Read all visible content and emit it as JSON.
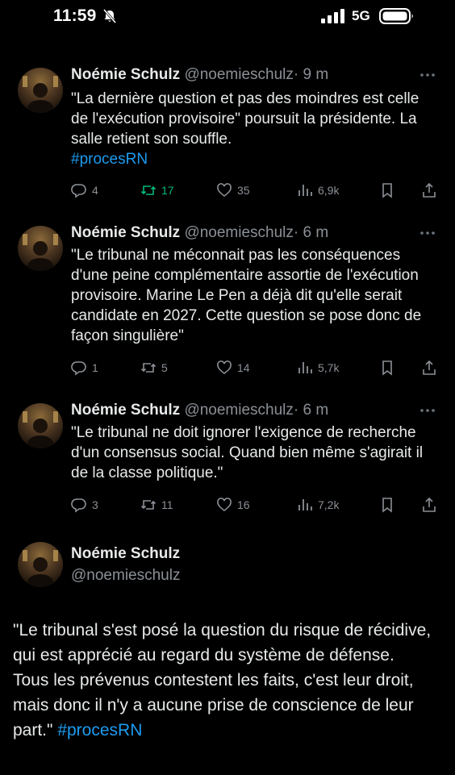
{
  "status_bar": {
    "time": "11:59",
    "network": "5G"
  },
  "tweets": [
    {
      "name": "Noémie Schulz",
      "handle": "@noemieschulz",
      "time": "· 9 m",
      "text": "\"La dernière question et pas des moindres est celle de l'exécution provisoire\" poursuit la présidente. La salle retient son souffle.",
      "hashtag": "#procesRN",
      "replies": "4",
      "retweets": "17",
      "likes": "35",
      "views": "6,9k"
    },
    {
      "name": "Noémie Schulz",
      "handle": "@noemieschulz",
      "time": "· 6 m",
      "text": "\"Le tribunal ne méconnait pas les conséquences d'une peine complémentaire assortie de l'exécution provisoire. Marine Le Pen a déjà dit qu'elle serait candidate en 2027. Cette question se pose donc de façon singulière\"",
      "hashtag": "",
      "replies": "1",
      "retweets": "5",
      "likes": "14",
      "views": "5,7k"
    },
    {
      "name": "Noémie Schulz",
      "handle": "@noemieschulz",
      "time": "· 6 m",
      "text": "\"Le tribunal ne doit ignorer l'exigence de recherche d'un consensus social. Quand bien même s'agirait il de la classe politique.\"",
      "hashtag": "",
      "replies": "3",
      "retweets": "11",
      "likes": "16",
      "views": "7,2k"
    }
  ],
  "main_tweet": {
    "name": "Noémie Schulz",
    "handle": "@noemieschulz",
    "text": "\"Le tribunal s'est posé la question du risque de récidive, qui est apprécié au regard du système de défense.\nTous les prévenus contestent les faits, c'est leur droit, mais donc il n'y a aucune prise de conscience de leur part.\"",
    "hashtag": "#procesRN"
  },
  "icons": {
    "status": [
      "bell-slash-icon",
      "signal-icon",
      "battery-icon"
    ],
    "actions": [
      "reply-icon",
      "retweet-icon",
      "like-icon",
      "views-icon",
      "bookmark-icon",
      "share-icon"
    ],
    "more": "more-icon"
  },
  "colors": {
    "background": "#000000",
    "text": "#e7e9ea",
    "muted": "#8b9096",
    "link": "#1d9bf0",
    "retweet": "#00ba7c"
  }
}
